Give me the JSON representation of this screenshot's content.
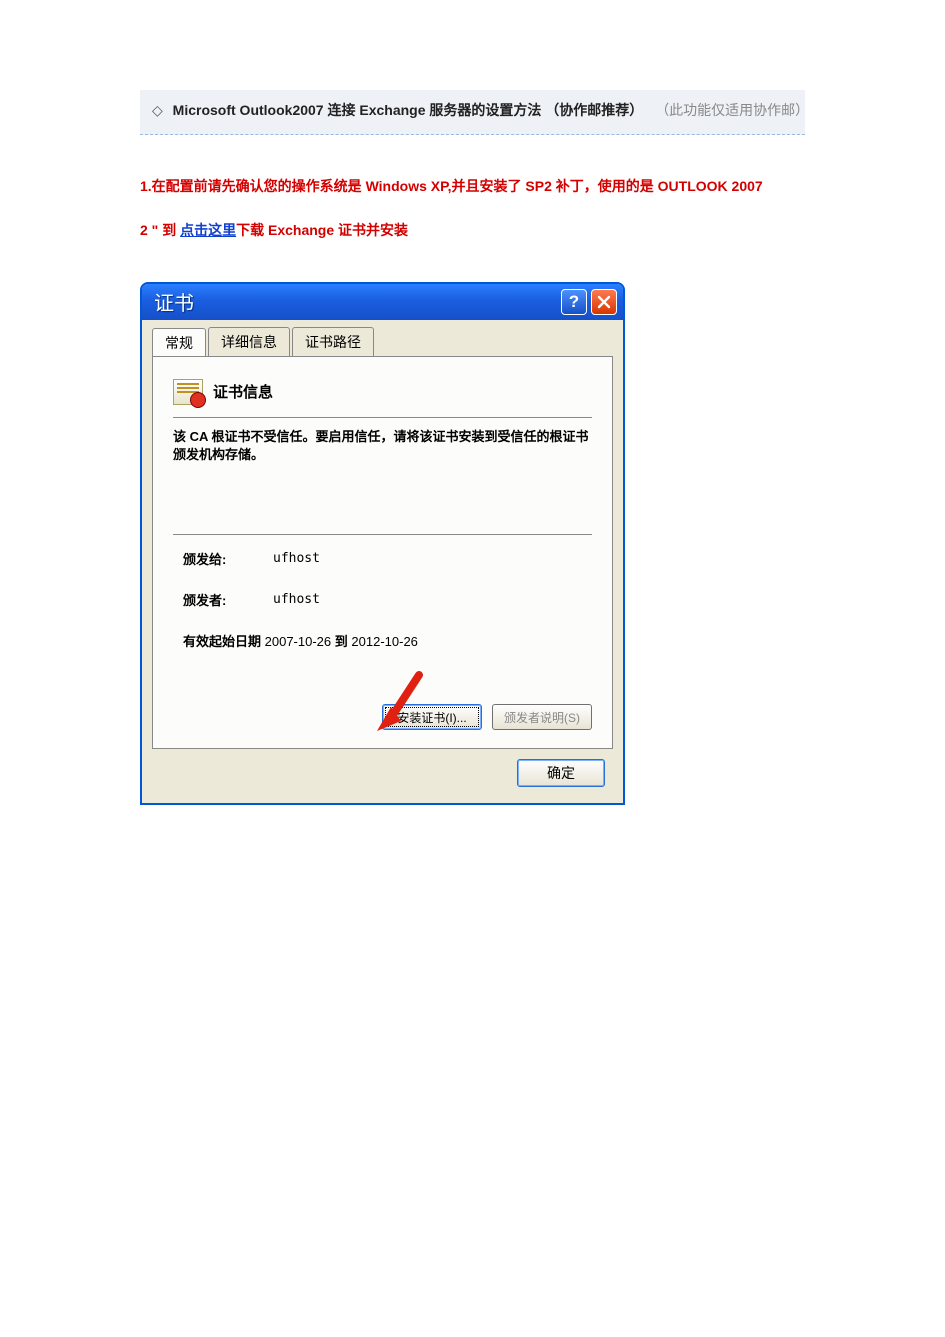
{
  "header": {
    "title": "Microsoft  Outlook2007 连接 Exchange 服务器的设置方法 （协作邮推荐）",
    "note": "（此功能仅适用协作邮）"
  },
  "instructions": {
    "line1": "1.在配置前请先确认您的操作系统是 Windows  XP,并且安装了 SP2 补丁，使用的是 OUTLOOK  2007",
    "line2_prefix": "2 \" 到",
    "line2_link": "点击这里",
    "line2_suffix": "下载 Exchange 证书并安装"
  },
  "dialog": {
    "title": "证书",
    "tabs": {
      "general": "常规",
      "details": "详细信息",
      "path": "证书路径"
    },
    "cert_info_title": "证书信息",
    "warning": "该 CA 根证书不受信任。要启用信任，请将该证书安装到受信任的根证书颁发机构存储。",
    "issued_to_label": "颁发给:",
    "issued_to_value": "ufhost",
    "issued_by_label": "颁发者:",
    "issued_by_value": "ufhost",
    "valid_prefix": "有效起始日期",
    "valid_from": "2007-10-26",
    "valid_to_label": "到",
    "valid_to": "2012-10-26",
    "install_btn": "安装证书(I)...",
    "issuer_stmt_btn": "颁发者说明(S)",
    "ok_btn": "确定"
  }
}
